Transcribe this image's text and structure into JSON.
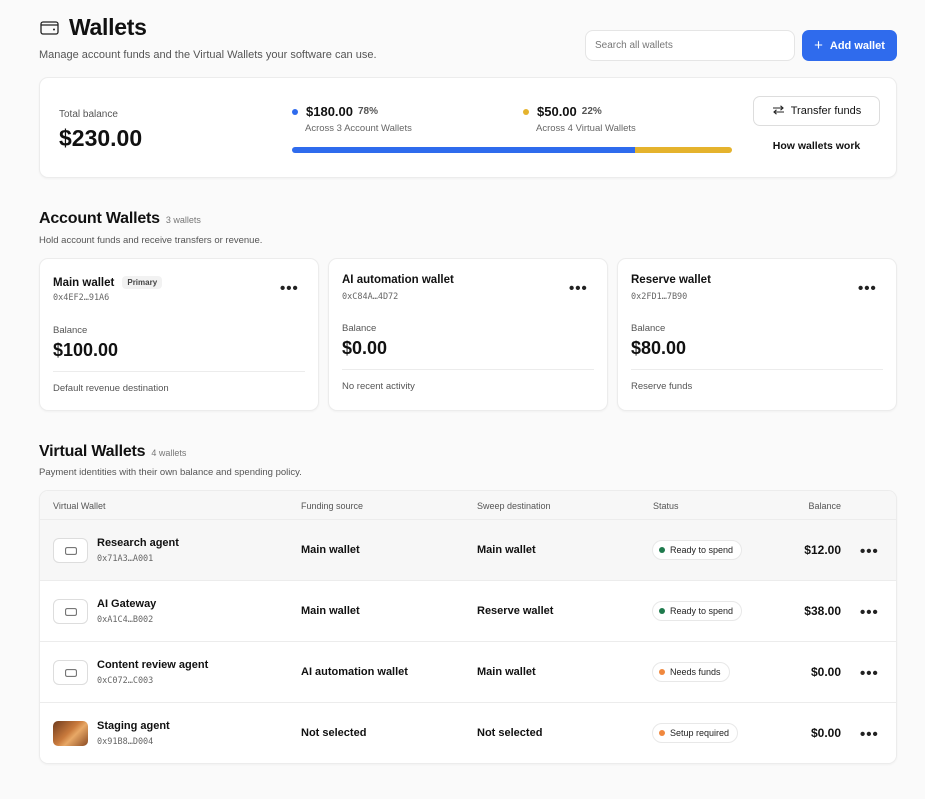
{
  "header": {
    "title": "Wallets",
    "subtitle": "Manage account funds and the Virtual Wallets your software can use.",
    "search_placeholder": "Search all wallets",
    "add_label": "Add wallet"
  },
  "summary": {
    "total_label": "Total balance",
    "total_value": "$230.00",
    "account": {
      "amount": "$180.00",
      "pct": "78%",
      "desc": "Across 3 Account Wallets",
      "fraction": 0.78,
      "color": "#2f6bed"
    },
    "virtual": {
      "amount": "$50.00",
      "pct": "22%",
      "desc": "Across 4 Virtual Wallets",
      "fraction": 0.22,
      "color": "#e5b32d"
    },
    "transfer_label": "Transfer funds",
    "how_label": "How wallets work"
  },
  "account_section": {
    "title": "Account Wallets",
    "count": "3 wallets",
    "subtitle": "Hold account funds and receive transfers or revenue.",
    "wallets": [
      {
        "name": "Main wallet",
        "badge": "Primary",
        "address": "0x4EF2…91A6",
        "balance_label": "Balance",
        "balance": "$100.00",
        "note": "Default revenue destination"
      },
      {
        "name": "AI automation wallet",
        "address": "0xC84A…4D72",
        "balance_label": "Balance",
        "balance": "$0.00",
        "note": "No recent activity"
      },
      {
        "name": "Reserve wallet",
        "address": "0x2FD1…7B90",
        "balance_label": "Balance",
        "balance": "$80.00",
        "note": "Reserve funds"
      }
    ]
  },
  "virtual_section": {
    "title": "Virtual Wallets",
    "count": "4 wallets",
    "subtitle": "Payment identities with their own balance and spending policy.",
    "columns": [
      "Virtual Wallet",
      "Funding source",
      "Sweep destination",
      "Status",
      "Balance"
    ],
    "rows": [
      {
        "name": "Research agent",
        "address": "0x71A3…A001",
        "funding": "Main wallet",
        "sweep": "Main wallet",
        "status": "Ready to spend",
        "status_color": "#1f7a4d",
        "balance": "$12.00"
      },
      {
        "name": "AI Gateway",
        "address": "0xA1C4…B002",
        "funding": "Main wallet",
        "sweep": "Reserve wallet",
        "status": "Ready to spend",
        "status_color": "#1f7a4d",
        "balance": "$38.00"
      },
      {
        "name": "Content review agent",
        "address": "0xC072…C003",
        "funding": "AI automation wallet",
        "sweep": "Main wallet",
        "status": "Needs funds",
        "status_color": "#f0883e",
        "balance": "$0.00"
      },
      {
        "name": "Staging agent",
        "address": "0x91B8…D004",
        "funding": "Not selected",
        "sweep": "Not selected",
        "status": "Setup required",
        "status_color": "#f0883e",
        "balance": "$0.00"
      }
    ]
  },
  "icons": {
    "title": "wallet-icon",
    "add": "plus-icon",
    "transfer": "arrows-swap-icon",
    "more": "more-horizontal-icon",
    "card": "card-icon"
  }
}
